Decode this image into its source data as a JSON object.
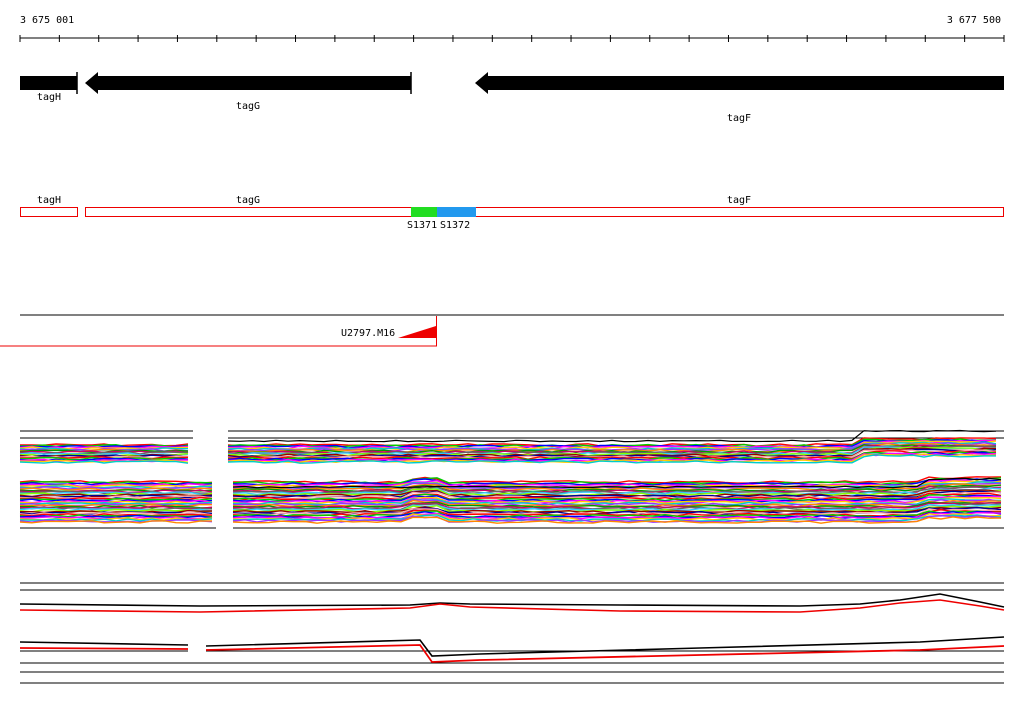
{
  "coordinates": {
    "start": "3 675 001",
    "end": "3 677 500"
  },
  "genes": [
    {
      "name": "tagH",
      "strand": "-"
    },
    {
      "name": "tagG",
      "strand": "-"
    },
    {
      "name": "tagF",
      "strand": "-"
    }
  ],
  "segments": [
    {
      "name": "S1371",
      "color": "#22dd22"
    },
    {
      "name": "S1372",
      "color": "#2299ee"
    }
  ],
  "transcript": {
    "name": "U2797.M16",
    "color": "#ee0000"
  },
  "colors": {
    "gene_arrow": "#000000",
    "segment_outline": "#ee0000",
    "profile_lines": [
      "#ff0000",
      "#00cc00",
      "#0000ff",
      "#ff00ff",
      "#ffcc00",
      "#00cccc",
      "#9933ff",
      "#ff8800",
      "#009900",
      "#cc0066",
      "#666666",
      "#33ccff",
      "#88ff00",
      "#990000",
      "#000099",
      "#ffaaaa"
    ]
  }
}
